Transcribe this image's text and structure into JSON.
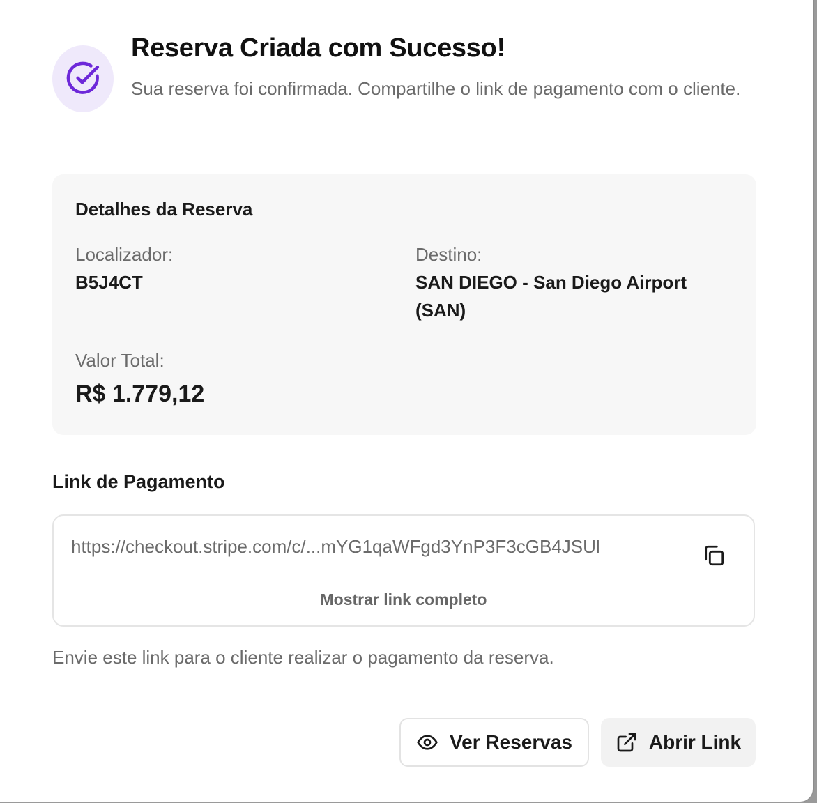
{
  "dialog": {
    "title": "Reserva Criada com Sucesso!",
    "subtitle": "Sua reserva foi confirmada. Compartilhe o link de pagamento com o cliente.",
    "success_icon": "check-circle-icon",
    "accent_color": "#6d28d9",
    "accent_bg": "#efe9fb"
  },
  "details": {
    "heading": "Detalhes da Reserva",
    "locator_label": "Localizador:",
    "locator_value": "B5J4CT",
    "destination_label": "Destino:",
    "destination_value": "SAN DIEGO - San Diego Airport (SAN)",
    "total_label": "Valor Total:",
    "total_value": "R$ 1.779,12"
  },
  "payment": {
    "heading": "Link de Pagamento",
    "url_display": "https://checkout.stripe.com/c/...mYG1qaWFgd3YnP3F3cGB4JSUl",
    "copy_icon": "copy-icon",
    "show_full_label": "Mostrar link completo",
    "hint": "Envie este link para o cliente realizar o pagamento da reserva."
  },
  "actions": {
    "view_reservations_label": "Ver Reservas",
    "view_icon": "eye-icon",
    "open_link_label": "Abrir Link",
    "open_icon": "external-link-icon"
  }
}
